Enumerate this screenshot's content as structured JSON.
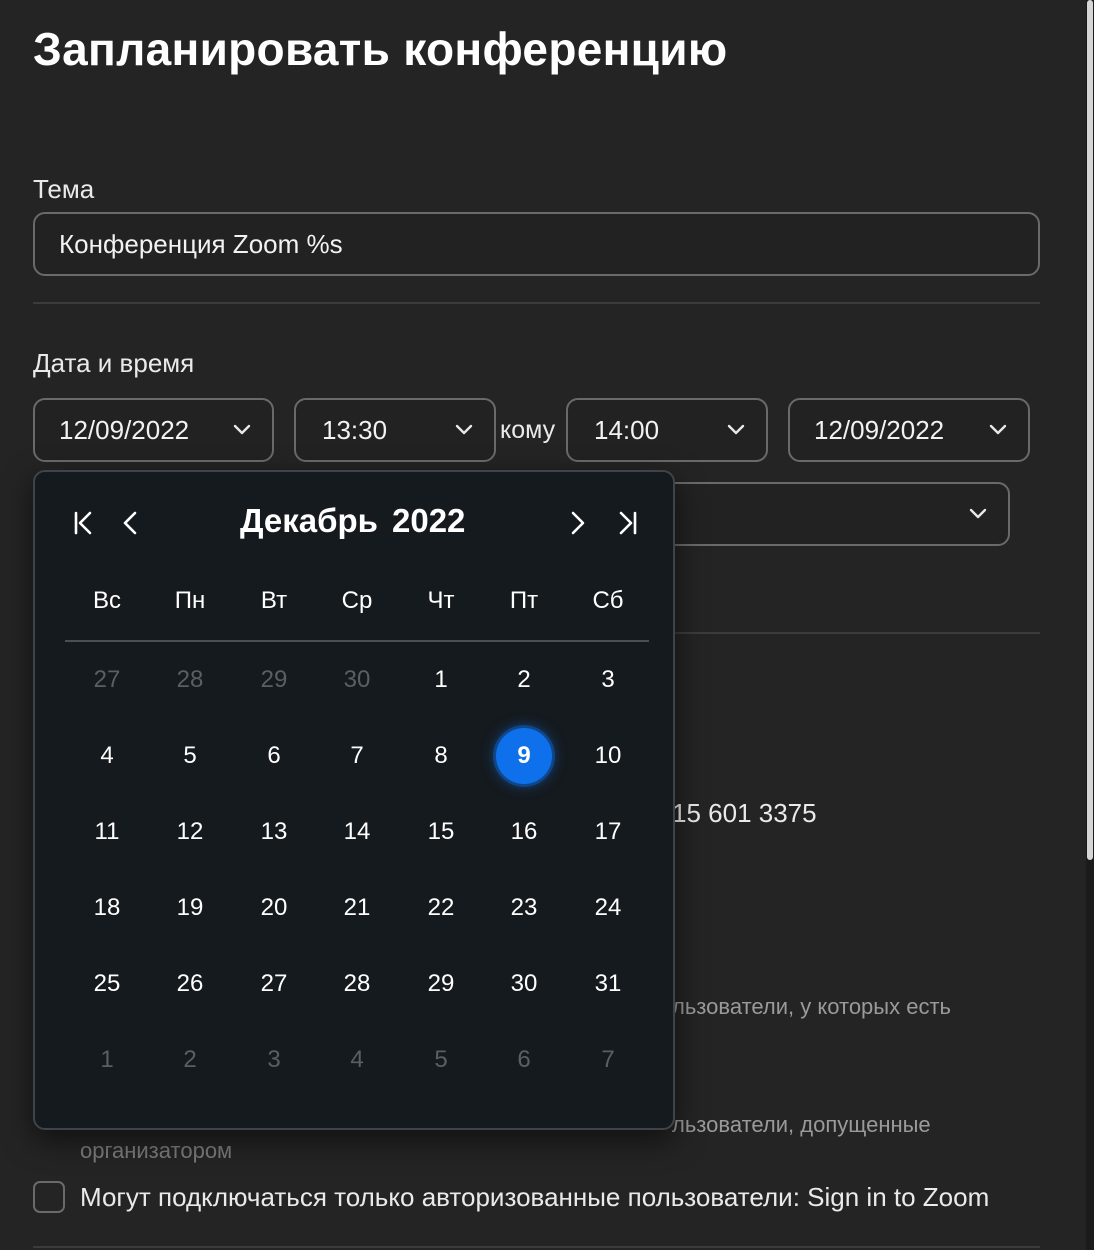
{
  "title": "Запланировать конференцию",
  "topic": {
    "label": "Тема",
    "value": "Конференция Zoom %s"
  },
  "datetime": {
    "label": "Дата и время",
    "start_date": "12/09/2022",
    "start_time": "13:30",
    "to_label": "кому",
    "end_time": "14:00",
    "end_date": "12/09/2022",
    "timezone_value": ""
  },
  "background": {
    "meeting_id_fragment": "15 601 3375",
    "option_text_1": "льзователи, у которых есть",
    "option_text_2": "льзователи, допущенные",
    "option_text_3": "организатором",
    "auth_checkbox_label": "Могут подключаться только авторизованные пользователи: Sign in to Zoom"
  },
  "calendar": {
    "month": "Декабрь",
    "year": "2022",
    "weekdays": [
      "Вс",
      "Пн",
      "Вт",
      "Ср",
      "Чт",
      "Пт",
      "Сб"
    ],
    "selected_day": "9",
    "weeks": [
      [
        "27",
        "28",
        "29",
        "30",
        "1",
        "2",
        "3"
      ],
      [
        "4",
        "5",
        "6",
        "7",
        "8",
        "9",
        "10"
      ],
      [
        "11",
        "12",
        "13",
        "14",
        "15",
        "16",
        "17"
      ],
      [
        "18",
        "19",
        "20",
        "21",
        "22",
        "23",
        "24"
      ],
      [
        "25",
        "26",
        "27",
        "28",
        "29",
        "30",
        "31"
      ],
      [
        "1",
        "2",
        "3",
        "4",
        "5",
        "6",
        "7"
      ]
    ],
    "icons": {
      "first": "first-page-icon",
      "prev": "chevron-left-icon",
      "next": "chevron-right-icon",
      "last": "last-page-icon"
    }
  },
  "colors": {
    "background": "#242424",
    "popup": "#151a1e",
    "accent": "#0e71eb",
    "muted_day": "#5a5f64"
  }
}
